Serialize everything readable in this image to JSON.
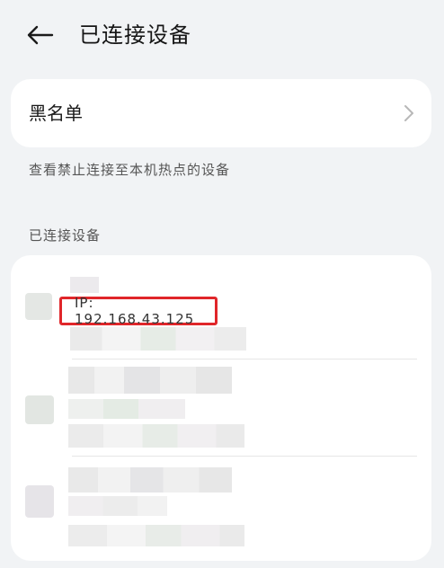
{
  "header": {
    "title": "已连接设备",
    "back_icon": "arrow-left-icon"
  },
  "blacklist": {
    "label": "黑名单",
    "chevron_icon": "chevron-right-icon"
  },
  "hint": "查看禁止连接至本机热点的设备",
  "section_title": "已连接设备",
  "devices": [
    {
      "ip": "IP: 192.168.43.125",
      "name": "",
      "mac": ""
    },
    {
      "ip": "",
      "name": "",
      "mac": ""
    },
    {
      "ip": "",
      "name": "",
      "mac": ""
    }
  ],
  "colors": {
    "highlight": "#e0262a",
    "background": "#f1f3f5",
    "card": "#ffffff"
  }
}
